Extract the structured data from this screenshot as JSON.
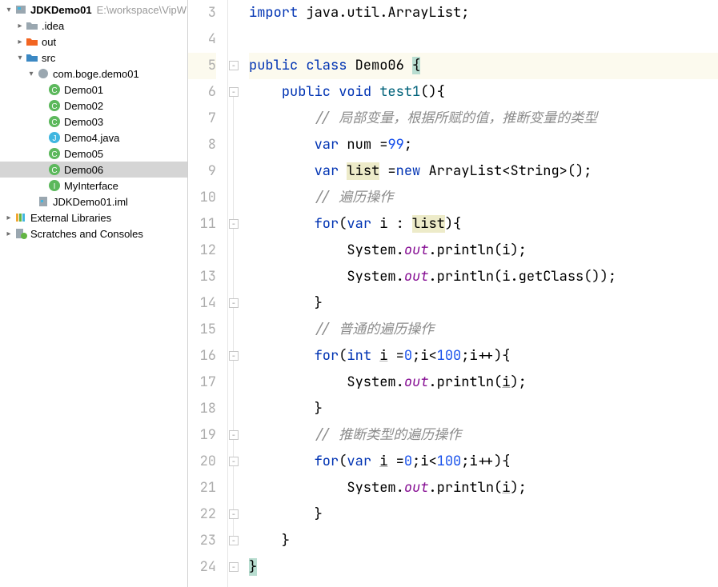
{
  "project": {
    "name": "JDKDemo01",
    "path": "E:\\workspace\\VipW"
  },
  "tree": {
    "idea": ".idea",
    "out": "out",
    "src": "src",
    "pkg": "com.boge.demo01",
    "demo01": "Demo01",
    "demo02": "Demo02",
    "demo03": "Demo03",
    "demo4java": "Demo4.java",
    "demo05": "Demo05",
    "demo06": "Demo06",
    "myinterface": "MyInterface",
    "iml": "JDKDemo01.iml",
    "ext_libs": "External Libraries",
    "scratches": "Scratches and Consoles"
  },
  "code": {
    "l3": "import java.util.ArrayList;",
    "l5_kw1": "public",
    "l5_kw2": "class",
    "l5_cls": "Demo06",
    "l6_kw1": "public",
    "l6_kw2": "void",
    "l6_fn": "test1",
    "l7_cmt": "// 局部变量，根据所赋的值，推断变量的类型",
    "l8_kw": "var",
    "l8_var": "num",
    "l8_num": "99",
    "l9_kw": "var",
    "l9_var": "list",
    "l9_kw2": "new",
    "l9_type": "ArrayList<String>",
    "l10_cmt": "// 遍历操作",
    "l11_kw": "for",
    "l11_kw2": "var",
    "l11_i": "i",
    "l11_list": "list",
    "l12_sys": "System",
    "l12_out": "out",
    "l12_pl": "println",
    "l12_arg": "i",
    "l13_sys": "System",
    "l13_out": "out",
    "l13_pl": "println",
    "l13_arg": "i.getClass()",
    "l15_cmt": "// 普通的遍历操作",
    "l16_kw": "for",
    "l16_type": "int",
    "l16_i": "i",
    "l16_n0": "0",
    "l16_n100": "100",
    "l17_sys": "System",
    "l17_out": "out",
    "l17_pl": "println",
    "l17_arg": "i",
    "l19_cmt": "// 推断类型的遍历操作",
    "l20_kw": "for",
    "l20_type": "var",
    "l20_i": "i",
    "l20_n0": "0",
    "l20_n100": "100",
    "l21_sys": "System",
    "l21_out": "out",
    "l21_pl": "println",
    "l21_arg": "i"
  },
  "lines": [
    "3",
    "4",
    "5",
    "6",
    "7",
    "8",
    "9",
    "10",
    "11",
    "12",
    "13",
    "14",
    "15",
    "16",
    "17",
    "18",
    "19",
    "20",
    "21",
    "22",
    "23",
    "24"
  ]
}
